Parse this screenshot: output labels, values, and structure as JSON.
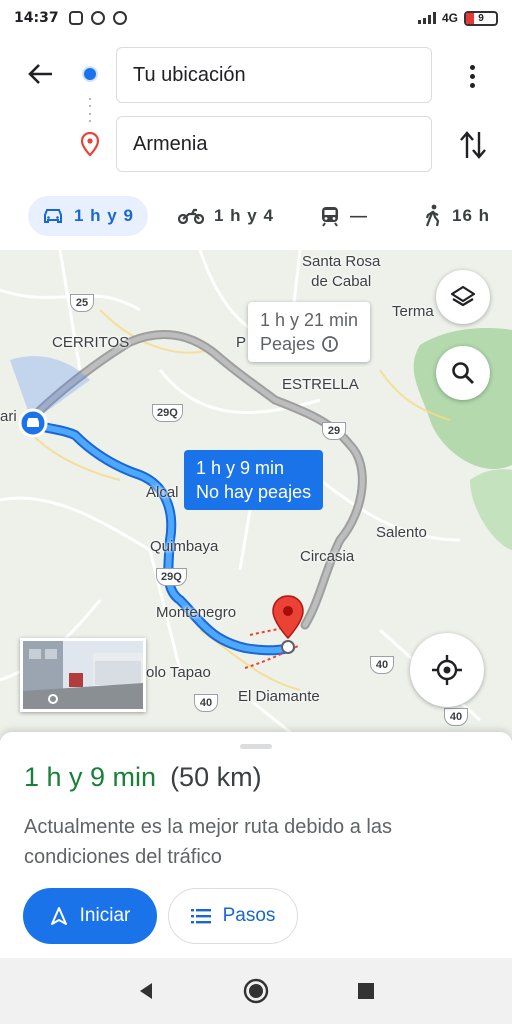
{
  "status_bar": {
    "time": "14:37",
    "network": "4G",
    "battery": "9"
  },
  "header": {
    "origin_value": "Tu ubicación",
    "destination_value": "Armenia"
  },
  "modes": [
    {
      "name": "car",
      "label": "1 h y 9",
      "active": true
    },
    {
      "name": "motorcycle",
      "label": "1 h y 4",
      "active": false
    },
    {
      "name": "transit",
      "label": "—",
      "active": false
    },
    {
      "name": "walk",
      "label": "16 h",
      "active": false
    }
  ],
  "map": {
    "places": {
      "santa_rosa": "Santa Rosa\nde Cabal",
      "termales": "Terma",
      "cerritos": "CERRITOS",
      "p_label": "P",
      "estrella": "ESTRELLA",
      "pereira_edge": "ari",
      "alcala": "Alcal",
      "salento": "Salento",
      "quimbaya": "Quimbaya",
      "circasia": "Circasia",
      "montenegro": "Montenegro",
      "pueblo_tapao": "olo Tapao",
      "el_diamante": "El Diamante"
    },
    "shields": {
      "r25": "25",
      "r29q_a": "29Q",
      "r29": "29",
      "r29q_b": "29Q",
      "r40_a": "40",
      "r40_b": "40",
      "r40_c": "40"
    },
    "alt_route": {
      "time": "1 h y 21 min",
      "note": "Peajes"
    },
    "main_route": {
      "time": "1 h y 9 min",
      "note": "No hay peajes"
    }
  },
  "sheet": {
    "duration": "1 h y 9 min",
    "distance": "(50 km)",
    "description": "Actualmente es la mejor ruta debido a las condiciones del tráfico",
    "start_label": "Iniciar",
    "steps_label": "Pasos"
  },
  "colors": {
    "accent": "#1a73e8",
    "route": "#4285f4",
    "alt_route": "#9e9e9e",
    "duration_green": "#188038",
    "pin": "#ea4335"
  }
}
